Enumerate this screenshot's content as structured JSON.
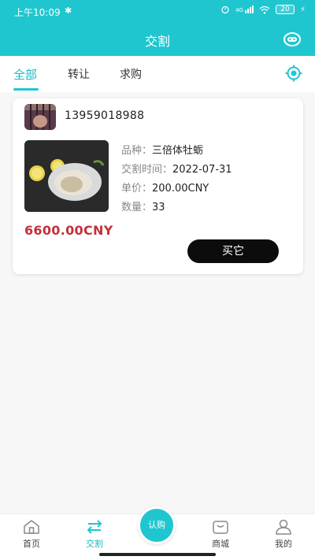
{
  "status": {
    "time": "上午10:09",
    "signal": "4G",
    "battery": "20"
  },
  "header": {
    "title": "交割"
  },
  "tabs": [
    {
      "label": "全部",
      "active": true
    },
    {
      "label": "转让",
      "active": false
    },
    {
      "label": "求购",
      "active": false
    }
  ],
  "listing": {
    "seller_phone": "13959018988",
    "fields": [
      {
        "key": "品种：",
        "value": "三倍体牡蛎"
      },
      {
        "key": "交割时间：",
        "value": "2022-07-31"
      },
      {
        "key": "单价：",
        "value": "200.00CNY"
      },
      {
        "key": "数量：",
        "value": "33"
      }
    ],
    "total": "6600.00CNY",
    "buy_label": "买它"
  },
  "bottom_nav": {
    "items": [
      {
        "label": "首页",
        "icon": "home-icon"
      },
      {
        "label": "交割",
        "icon": "swap-arrows-icon",
        "active": true
      },
      {
        "label": "商城",
        "icon": "shop-icon"
      },
      {
        "label": "我的",
        "icon": "profile-icon"
      }
    ],
    "center_label": "认购"
  },
  "colors": {
    "accent": "#20c6cf",
    "price": "#c2313a",
    "button": "#0c0c0c"
  }
}
